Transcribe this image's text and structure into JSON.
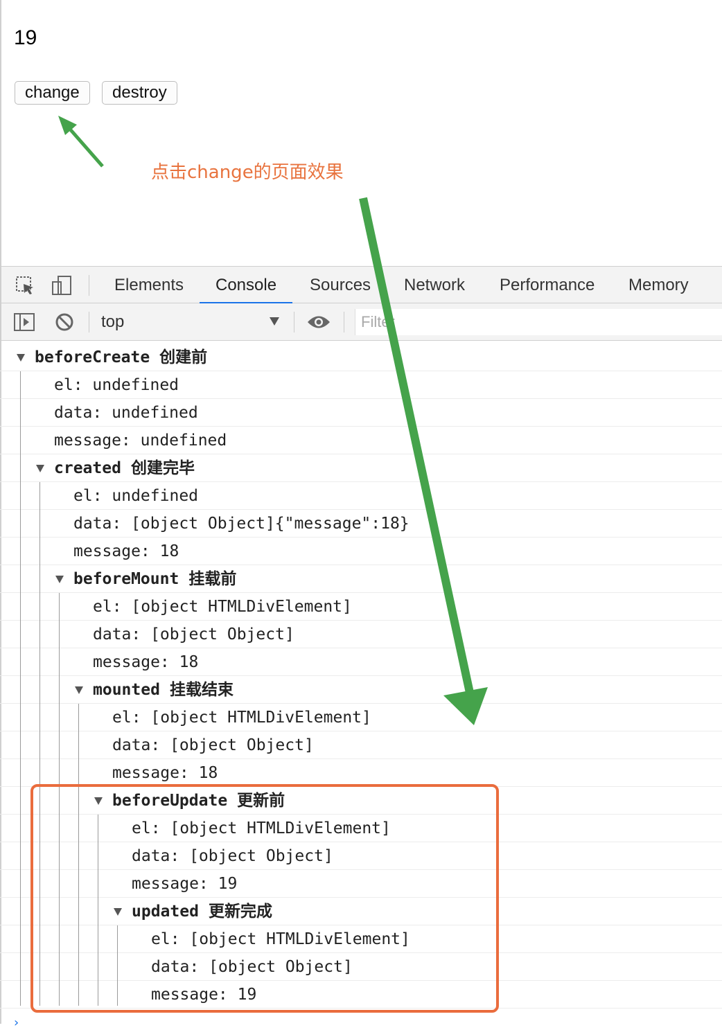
{
  "page": {
    "counter": "19",
    "buttons": {
      "change": "change",
      "destroy": "destroy"
    },
    "annotation": "点击change的页面效果"
  },
  "devtools": {
    "tabs": [
      "Elements",
      "Console",
      "Sources",
      "Network",
      "Performance",
      "Memory"
    ],
    "active_tab": "Console",
    "context": "top",
    "filter_placeholder": "Filter",
    "accent_color": "#1a73e8"
  },
  "console": {
    "rows": [
      {
        "level": 0,
        "group": true,
        "hook": "beforeCreate",
        "label": "创建前"
      },
      {
        "level": 1,
        "text": "el: undefined"
      },
      {
        "level": 1,
        "text": "data: undefined"
      },
      {
        "level": 1,
        "text": "message: undefined"
      },
      {
        "level": 1,
        "group": true,
        "hook": "created",
        "label": "创建完毕"
      },
      {
        "level": 2,
        "text": "el: undefined"
      },
      {
        "level": 2,
        "text": "data: [object Object]{\"message\":18}"
      },
      {
        "level": 2,
        "text": "message: 18"
      },
      {
        "level": 2,
        "group": true,
        "hook": "beforeMount",
        "label": "挂载前"
      },
      {
        "level": 3,
        "text": "el: [object HTMLDivElement]"
      },
      {
        "level": 3,
        "text": "data: [object Object]"
      },
      {
        "level": 3,
        "text": "message: 18"
      },
      {
        "level": 3,
        "group": true,
        "hook": "mounted",
        "label": "挂载结束"
      },
      {
        "level": 4,
        "text": "el: [object HTMLDivElement]"
      },
      {
        "level": 4,
        "text": "data: [object Object]"
      },
      {
        "level": 4,
        "text": "message: 18"
      },
      {
        "level": 4,
        "group": true,
        "hook": "beforeUpdate",
        "label": "更新前"
      },
      {
        "level": 5,
        "text": "el: [object HTMLDivElement]"
      },
      {
        "level": 5,
        "text": "data: [object Object]"
      },
      {
        "level": 5,
        "text": "message: 19"
      },
      {
        "level": 5,
        "group": true,
        "hook": "updated",
        "label": "更新完成"
      },
      {
        "level": 6,
        "text": "el: [object HTMLDivElement]"
      },
      {
        "level": 6,
        "text": "data: [object Object]"
      },
      {
        "level": 6,
        "text": "message: 19"
      }
    ],
    "prompt": "›"
  },
  "colors": {
    "annotation_text": "#e8733e",
    "highlight_box": "#ea6c3d",
    "arrow_green": "#45a34b"
  }
}
